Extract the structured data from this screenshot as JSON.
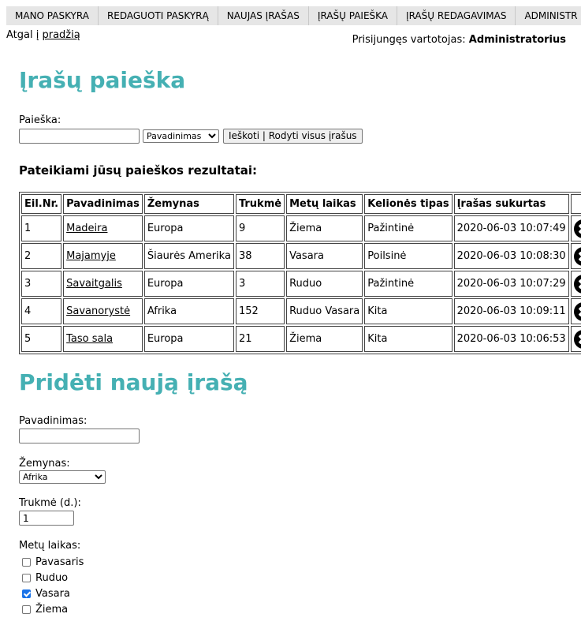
{
  "nav": {
    "items": [
      "MANO PASKYRA",
      "REDAGUOTI PASKYRĄ",
      "NAUJAS ĮRAŠAS",
      "ĮRAŠŲ PAIEŠKA",
      "ĮRAŠŲ REDAGAVIMAS",
      "ADMINISTR"
    ]
  },
  "back": {
    "prefix": "Atgal į",
    "link": "pradžią"
  },
  "user": {
    "prefix": "Prisijungęs vartotojas:",
    "name": "Administratorius"
  },
  "search": {
    "title": "Įrašų paieška",
    "label": "Paieška:",
    "input_value": "",
    "select_value": "Pavadinimas",
    "button_label": "Ieškoti  |  Rodyti visus įrašus"
  },
  "results": {
    "title": "Pateikiami jūsų paieškos rezultatai:",
    "headers": [
      "Eil.Nr.",
      "Pavadinimas",
      "Žemynas",
      "Trukmė",
      "Metų laikas",
      "Kelionės tipas",
      "Įrašas sukurtas"
    ],
    "rows": [
      [
        "1",
        "Madeira",
        "Europa",
        "9",
        "Žiema",
        "Pažintinė",
        "2020-06-03 10:07:49"
      ],
      [
        "2",
        "Majamyje",
        "Šiaurės Amerika",
        "38",
        "Vasara",
        "Poilsinė",
        "2020-06-03 10:08:30"
      ],
      [
        "3",
        "Savaitgalis",
        "Europa",
        "3",
        "Ruduo",
        "Pažintinė",
        "2020-06-03 10:07:29"
      ],
      [
        "4",
        "Savanorystė",
        "Afrika",
        "152",
        "Ruduo Vasara",
        "Kita",
        "2020-06-03 10:09:11"
      ],
      [
        "5",
        "Taso sala",
        "Europa",
        "21",
        "Žiema",
        "Kita",
        "2020-06-03 10:06:53"
      ]
    ],
    "delete_icon": "close-circle-icon"
  },
  "add": {
    "title": "Pridėti naują įrašą",
    "name_label": "Pavadinimas:",
    "name_value": "",
    "continent_label": "Žemynas:",
    "continent_value": "Afrika",
    "duration_label": "Trukmė (d.):",
    "duration_value": "1",
    "season_label": "Metų laikas:",
    "seasons": [
      {
        "label": "Pavasaris",
        "checked": false
      },
      {
        "label": "Ruduo",
        "checked": false
      },
      {
        "label": "Vasara",
        "checked": true
      },
      {
        "label": "Žiema",
        "checked": false
      }
    ]
  },
  "colors": {
    "heading": "#45b0b3",
    "navbar_bg": "#e6e6e6",
    "checkbox_checked": "#1a73e8"
  }
}
